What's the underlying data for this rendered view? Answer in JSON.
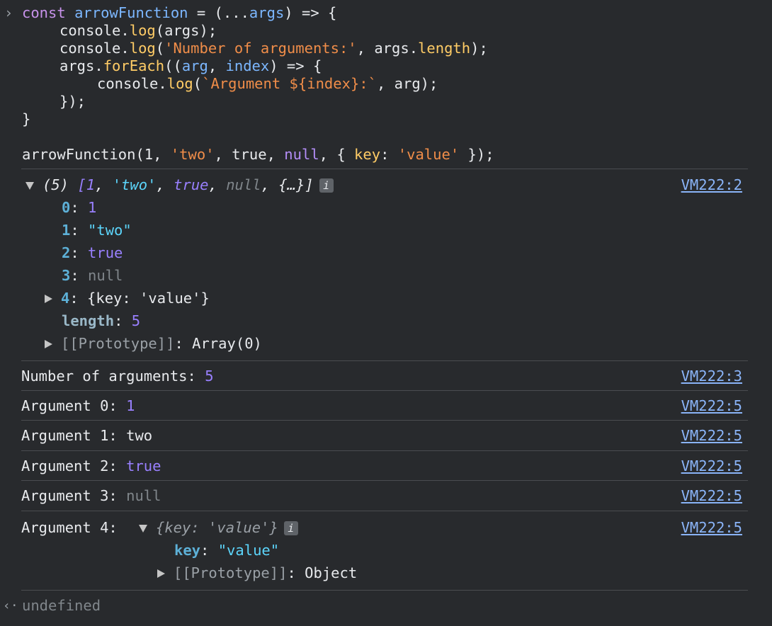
{
  "input": {
    "prompt_symbol": "›",
    "code_lines": [
      [
        "const",
        " ",
        "arrowFunction",
        " = (...",
        "args",
        ") => {"
      ],
      [
        "console",
        ".",
        "log",
        "(args);"
      ],
      [
        "console",
        ".",
        "log",
        "(",
        "'Number of arguments:'",
        ", args.",
        "length",
        ");"
      ],
      [
        "args",
        ".",
        "forEach",
        "((",
        "arg",
        ", ",
        "index",
        ") => {"
      ],
      [
        "console",
        ".",
        "log",
        "(",
        "`Argument ${index}:`",
        ", arg);"
      ],
      [
        "});"
      ],
      [
        "}"
      ]
    ],
    "call_line": [
      "arrowFunction(1, ",
      "'two'",
      ", true, ",
      "null",
      ", { ",
      "key",
      ": ",
      "'value'",
      " });"
    ]
  },
  "log_array": {
    "summary_count": "(5)",
    "summary_items": [
      "[1",
      ", ",
      "'two'",
      ", ",
      "true",
      ", ",
      "null",
      ", ",
      "{…}",
      "]"
    ],
    "info_badge": "i",
    "source": "VM222:2",
    "entries": [
      {
        "key": "0",
        "value": "1",
        "kind": "num"
      },
      {
        "key": "1",
        "value": "\"two\"",
        "kind": "str"
      },
      {
        "key": "2",
        "value": "true",
        "kind": "num"
      },
      {
        "key": "3",
        "value": "null",
        "kind": "null"
      }
    ],
    "object_entry": {
      "key": "4",
      "preview": "{key: 'value'}"
    },
    "length_key": "length",
    "length_value": "5",
    "prototype_key": "[[Prototype]]",
    "prototype_value": "Array(0)"
  },
  "messages": [
    {
      "label": "Number of arguments: ",
      "value": "5",
      "kind": "num",
      "source": "VM222:3"
    },
    {
      "label": "Argument 0: ",
      "value": "1",
      "kind": "num",
      "source": "VM222:5"
    },
    {
      "label": "Argument 1: ",
      "value": "two",
      "kind": "plain",
      "source": "VM222:5"
    },
    {
      "label": "Argument 2: ",
      "value": "true",
      "kind": "num",
      "source": "VM222:5"
    },
    {
      "label": "Argument 3: ",
      "value": "null",
      "kind": "null",
      "source": "VM222:5"
    }
  ],
  "arg4": {
    "label": "Argument 4: ",
    "preview": "{key: 'value'}",
    "info_badge": "i",
    "source": "VM222:5",
    "key_name": "key",
    "key_value": "\"value\"",
    "prototype_key": "[[Prototype]]",
    "prototype_value": "Object"
  },
  "result": {
    "symbol": "‹·",
    "value": "undefined"
  }
}
